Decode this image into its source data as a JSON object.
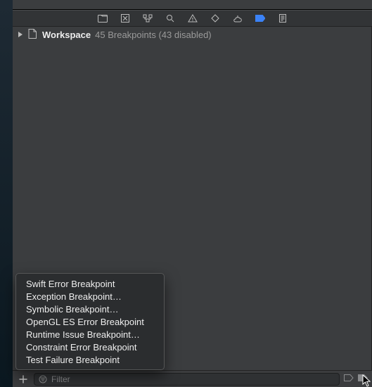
{
  "navigator": {
    "items": [
      {
        "name": "project-navigator-icon"
      },
      {
        "name": "source-control-navigator-icon"
      },
      {
        "name": "symbol-navigator-icon"
      },
      {
        "name": "find-navigator-icon"
      },
      {
        "name": "issue-navigator-icon"
      },
      {
        "name": "test-navigator-icon"
      },
      {
        "name": "debug-navigator-icon"
      },
      {
        "name": "breakpoint-navigator-icon"
      },
      {
        "name": "report-navigator-icon"
      }
    ],
    "active_index": 7
  },
  "tree": {
    "root": {
      "label": "Workspace",
      "summary": "45 Breakpoints (43 disabled)"
    }
  },
  "context_menu": {
    "items": [
      "Swift Error Breakpoint",
      "Exception Breakpoint…",
      "Symbolic Breakpoint…",
      "OpenGL ES Error Breakpoint",
      "Runtime Issue Breakpoint…",
      "Constraint Error Breakpoint",
      "Test Failure Breakpoint"
    ]
  },
  "bottom": {
    "add_tooltip": "Add Breakpoint",
    "filter_placeholder": "Filter"
  }
}
